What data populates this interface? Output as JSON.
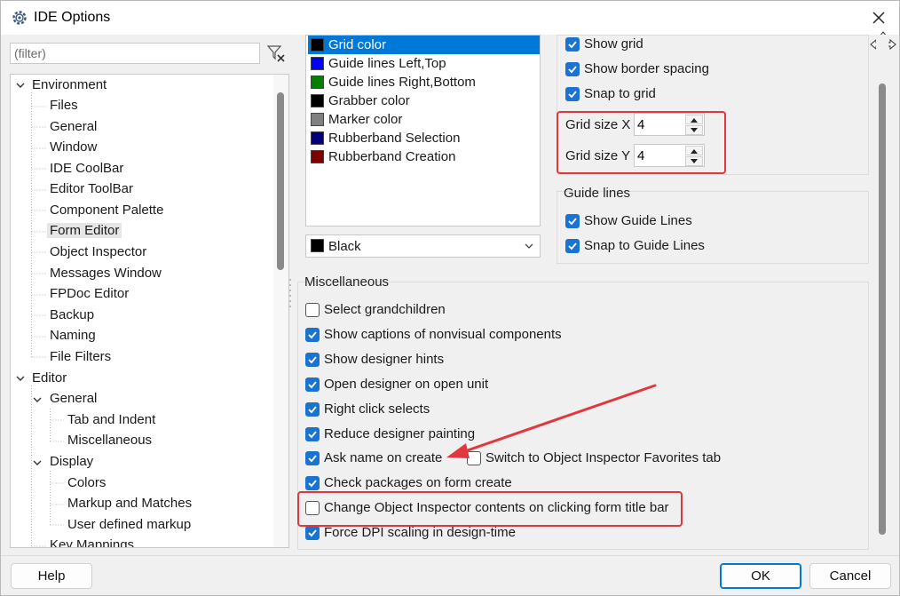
{
  "window": {
    "title": "IDE Options"
  },
  "filter": {
    "placeholder": "(filter)"
  },
  "tree": {
    "items": [
      {
        "label": "Environment",
        "level": 0,
        "expanded": true
      },
      {
        "label": "Files",
        "level": 1
      },
      {
        "label": "General",
        "level": 1
      },
      {
        "label": "Window",
        "level": 1
      },
      {
        "label": "IDE CoolBar",
        "level": 1
      },
      {
        "label": "Editor ToolBar",
        "level": 1
      },
      {
        "label": "Component Palette",
        "level": 1
      },
      {
        "label": "Form Editor",
        "level": 1,
        "selected": true
      },
      {
        "label": "Object Inspector",
        "level": 1
      },
      {
        "label": "Messages Window",
        "level": 1
      },
      {
        "label": "FPDoc Editor",
        "level": 1
      },
      {
        "label": "Backup",
        "level": 1
      },
      {
        "label": "Naming",
        "level": 1
      },
      {
        "label": "File Filters",
        "level": 1
      },
      {
        "label": "Editor",
        "level": 0,
        "expanded": true
      },
      {
        "label": "General",
        "level": 1,
        "expanded": true
      },
      {
        "label": "Tab and Indent",
        "level": 2
      },
      {
        "label": "Miscellaneous",
        "level": 2
      },
      {
        "label": "Display",
        "level": 1,
        "expanded": true
      },
      {
        "label": "Colors",
        "level": 2
      },
      {
        "label": "Markup and Matches",
        "level": 2
      },
      {
        "label": "User defined markup",
        "level": 2
      },
      {
        "label": "Key Mappings",
        "level": 1
      }
    ]
  },
  "colors": {
    "items": [
      {
        "label": "Grid color",
        "swatch": "#000000",
        "selected": true
      },
      {
        "label": "Guide lines Left,Top",
        "swatch": "#0000ff"
      },
      {
        "label": "Guide lines Right,Bottom",
        "swatch": "#008000"
      },
      {
        "label": "Grabber color",
        "swatch": "#000000"
      },
      {
        "label": "Marker color",
        "swatch": "#808080"
      },
      {
        "label": "Rubberband Selection",
        "swatch": "#000080"
      },
      {
        "label": "Rubberband Creation",
        "swatch": "#800000"
      }
    ],
    "combo": {
      "value": "Black",
      "swatch": "#000000"
    }
  },
  "grid": {
    "show_grid": {
      "label": "Show grid",
      "checked": true
    },
    "show_border_spacing": {
      "label": "Show border spacing",
      "checked": true
    },
    "snap_to_grid": {
      "label": "Snap to grid",
      "checked": true
    },
    "size_x": {
      "label": "Grid size X",
      "value": "4"
    },
    "size_y": {
      "label": "Grid size Y",
      "value": "4"
    }
  },
  "guide": {
    "title": "Guide lines",
    "show": {
      "label": "Show Guide Lines",
      "checked": true
    },
    "snap": {
      "label": "Snap to Guide Lines",
      "checked": true
    }
  },
  "misc": {
    "title": "Miscellaneous",
    "items": [
      {
        "label": "Select grandchildren",
        "checked": false
      },
      {
        "label": "Show captions of nonvisual components",
        "checked": true
      },
      {
        "label": "Show designer hints",
        "checked": true
      },
      {
        "label": "Open designer on open unit",
        "checked": true
      },
      {
        "label": "Right click selects",
        "checked": true
      },
      {
        "label": "Reduce designer painting",
        "checked": true
      },
      {
        "label": "Ask name on create",
        "checked": true
      },
      {
        "label": "Switch to Object Inspector Favorites tab",
        "checked": false
      },
      {
        "label": "Check packages on form create",
        "checked": true
      },
      {
        "label": "Change Object Inspector contents on clicking form title bar",
        "checked": false
      },
      {
        "label": "Force DPI scaling in design-time",
        "checked": true
      }
    ]
  },
  "buttons": {
    "help": "Help",
    "ok": "OK",
    "cancel": "Cancel"
  },
  "colors_theme": {
    "accent": "#1a73d0",
    "selection": "#0078d7",
    "highlight": "#e0383e"
  }
}
